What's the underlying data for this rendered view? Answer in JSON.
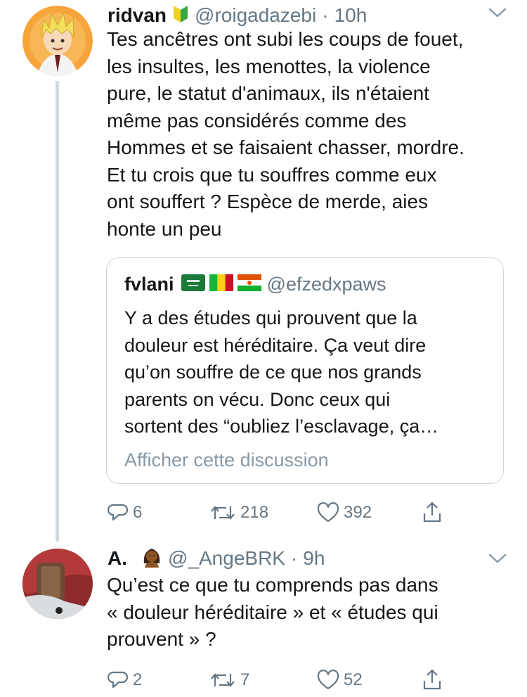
{
  "colors": {
    "text": "#14171a",
    "secondary": "#657786",
    "border": "#ccd6dd",
    "thread_line": "#cfd9de"
  },
  "tweets": [
    {
      "name": "ridvan",
      "badge_icon": "beginner-symbol-icon",
      "handle": "@roigadazebi",
      "separator": "·",
      "time": "10h",
      "text": "Tes ancêtres ont subi les coups de fouet,\nles insultes, les menottes, la violence\npure, le statut d'animaux, ils n'étaient\nmême pas considérés comme des\nHommes et se faisaient chasser, mordre.\nEt tu crois que tu souffres comme eux\nont souffert ? Espèce de merde, aies\nhonte un peu",
      "quoted": {
        "name": "fvlani",
        "flags": [
          "flag-saudi-arabia-icon",
          "flag-mali-icon",
          "flag-niger-icon"
        ],
        "handle": "@efzedxpaws",
        "text": "Y a des études qui prouvent que la\ndouleur est héréditaire. Ça veut dire\nqu’on souffre de ce que nos grands\nparents on vécu. Donc ceux qui\nsortent des “oubliez l’esclavage, ça…",
        "show_thread": "Afficher cette discussion"
      },
      "actions": {
        "replies": "6",
        "retweets": "218",
        "likes": "392"
      }
    },
    {
      "name": "A.",
      "badge_icon": "woman-emoji-icon",
      "handle": "@_AngeBRK",
      "separator": "·",
      "time": "9h",
      "text": "Qu’est ce que tu comprends pas dans\n« douleur héréditaire » et « études qui\nprouvent » ?",
      "actions": {
        "replies": "2",
        "retweets": "7",
        "likes": "52"
      }
    }
  ]
}
